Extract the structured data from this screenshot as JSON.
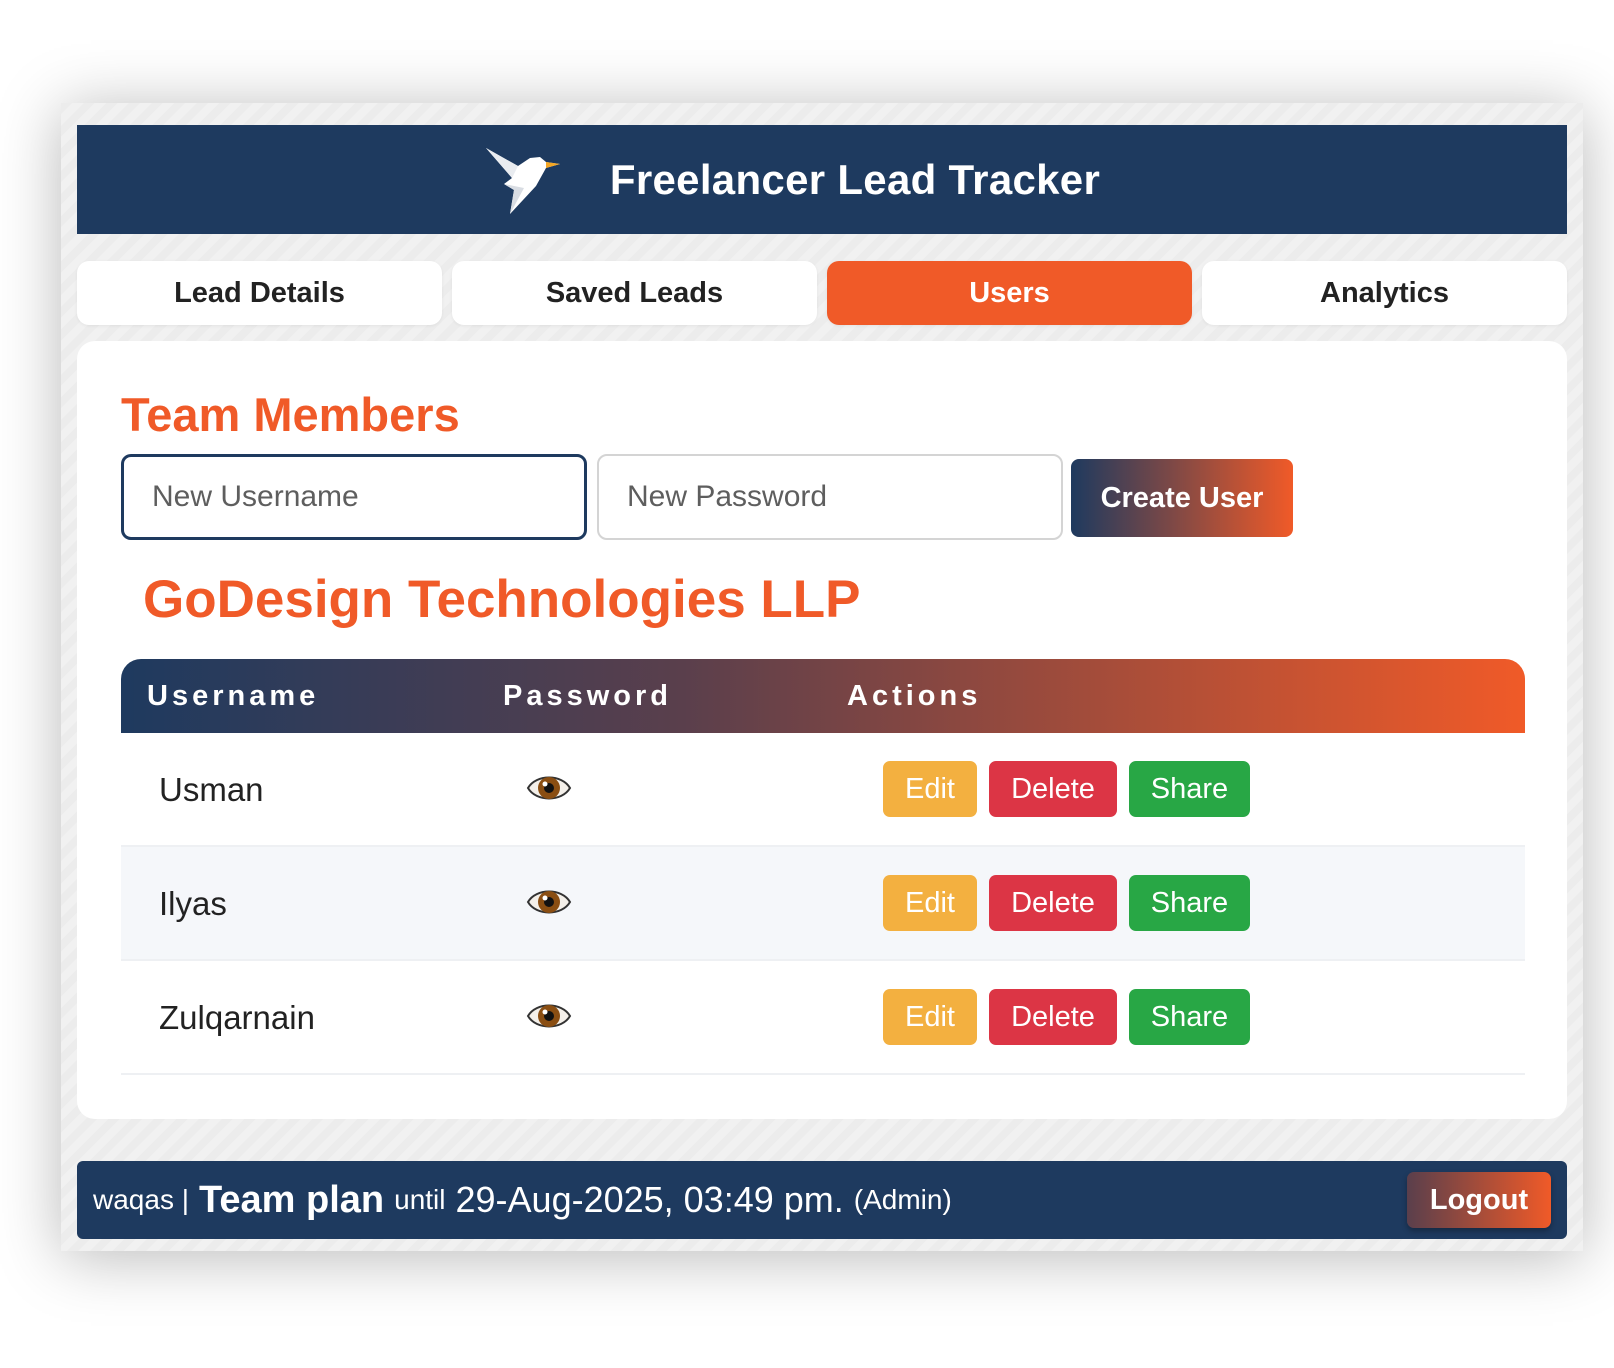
{
  "app": {
    "title": "Freelancer Lead Tracker"
  },
  "tabs": [
    {
      "label": "Lead Details",
      "active": false
    },
    {
      "label": "Saved Leads",
      "active": false
    },
    {
      "label": "Users",
      "active": true
    },
    {
      "label": "Analytics",
      "active": false
    }
  ],
  "team": {
    "heading": "Team Members",
    "username_placeholder": "New Username",
    "password_placeholder": "New Password",
    "create_label": "Create User",
    "company": "GoDesign Technologies LLP"
  },
  "table": {
    "headers": [
      "Username",
      "Password",
      "Actions"
    ],
    "rows": [
      {
        "username": "Usman",
        "password_icon": "eye-icon",
        "actions": [
          "Edit",
          "Delete",
          "Share"
        ]
      },
      {
        "username": "Ilyas",
        "password_icon": "eye-icon",
        "actions": [
          "Edit",
          "Delete",
          "Share"
        ]
      },
      {
        "username": "Zulqarnain",
        "password_icon": "eye-icon",
        "actions": [
          "Edit",
          "Delete",
          "Share"
        ]
      }
    ]
  },
  "footer": {
    "user": "waqas |",
    "plan": "Team plan",
    "until": "until",
    "expiry": "29-Aug-2025, 03:49 pm.",
    "role": "(Admin)",
    "logout_label": "Logout"
  },
  "colors": {
    "brand_navy": "#1e3a5f",
    "brand_orange": "#f05a28",
    "edit": "#f3b040",
    "delete": "#dc3545",
    "share": "#28a745"
  }
}
